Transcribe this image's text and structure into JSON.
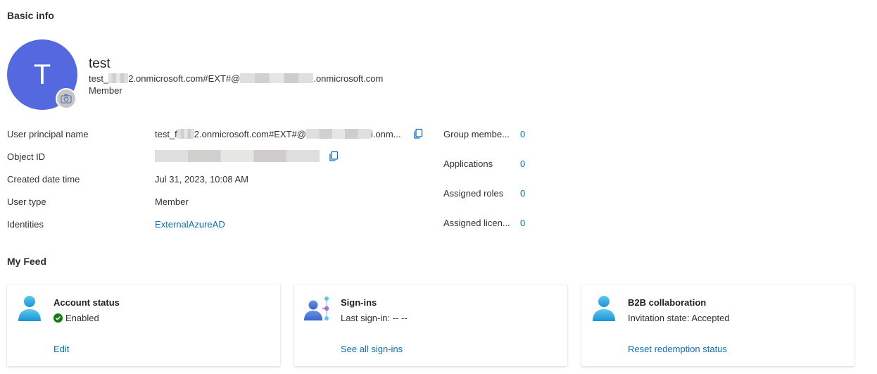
{
  "basic_info": {
    "section_title": "Basic info",
    "avatar_initial": "T",
    "name": "test",
    "email_prefix": "test_",
    "email_mid": "2.onmicrosoft.com#EXT#@",
    "email_suffix": ".onmicrosoft.com",
    "user_type": "Member"
  },
  "properties": [
    {
      "label": "User principal name",
      "value_prefix": "test_f",
      "value_mid": "2.onmicrosoft.com#EXT#@",
      "value_suffix": "i.onm..."
    },
    {
      "label": "Object ID",
      "value": ""
    },
    {
      "label": "Created date time",
      "value": "Jul 31, 2023, 10:08 AM"
    },
    {
      "label": "User type",
      "value": "Member"
    },
    {
      "label": "Identities",
      "value": "ExternalAzureAD"
    }
  ],
  "stats": [
    {
      "label": "Group membe...",
      "value": "0"
    },
    {
      "label": "Applications",
      "value": "0"
    },
    {
      "label": "Assigned roles",
      "value": "0"
    },
    {
      "label": "Assigned licen...",
      "value": "0"
    }
  ],
  "feed": {
    "section_title": "My Feed",
    "cards": [
      {
        "title": "Account status",
        "status": "Enabled",
        "link": "Edit",
        "icon": "user-icon"
      },
      {
        "title": "Sign-ins",
        "status": "Last sign-in: -- --",
        "link": "See all sign-ins",
        "icon": "sign-ins-icon"
      },
      {
        "title": "B2B collaboration",
        "status": "Invitation state: Accepted",
        "link": "Reset redemption status",
        "icon": "user-icon"
      }
    ]
  },
  "colors": {
    "avatar": "#5468e0",
    "link": "#0f6cbd",
    "enabled": "#107c10"
  }
}
